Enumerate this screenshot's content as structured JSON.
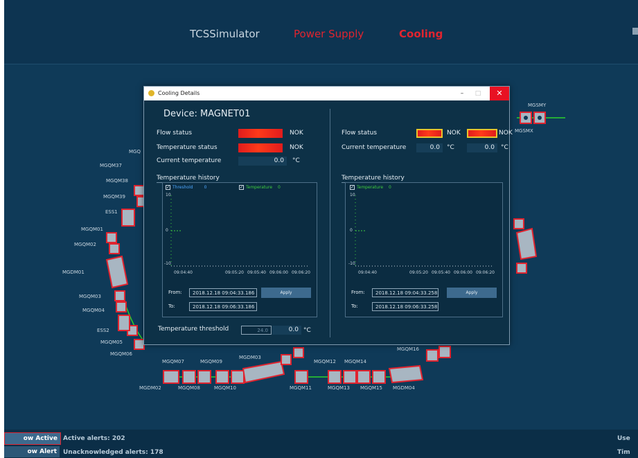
{
  "app": {
    "nav": [
      "TCSSimulator",
      "Power Supply",
      "Cooling"
    ]
  },
  "ring_labels": [
    "MGQM37",
    "MGQM38",
    "MGQM39",
    "ESS1",
    "MGQM01",
    "MGQM02",
    "MGDM01",
    "MGQM03",
    "MGQM04",
    "ESS2",
    "MGQM05",
    "MGQM06",
    "MGQM07",
    "MGQM09",
    "MGDM03",
    "MGQM12",
    "MGQM14",
    "MGQM16",
    "MGDM02",
    "MGQM08",
    "MGQM10",
    "MGQM11",
    "MGQM13",
    "MGQM15",
    "MGDM04",
    "MGSMY",
    "MGSMX",
    "MGQ"
  ],
  "dialog": {
    "title": "Cooling Details",
    "minimize": "–",
    "maximize": "□",
    "close": "✕",
    "device_label": "Device: MAGNET01",
    "left": {
      "flow_status_label": "Flow status",
      "flow_status_value": "NOK",
      "temp_status_label": "Temperature status",
      "temp_status_value": "NOK",
      "current_temp_label": "Current temperature",
      "current_temp_value": "0.0",
      "current_temp_unit": "°C",
      "history_label": "Temperature history",
      "legend": [
        {
          "label": "Threshold",
          "value": "0",
          "color": "#4da6ff"
        },
        {
          "label": "Temperature",
          "value": "0",
          "color": "#3fcf3f"
        }
      ],
      "y_ticks": [
        "10",
        "0",
        "-10"
      ],
      "x_ticks": [
        "09:04:40",
        "09:05:20",
        "09:05:40",
        "09:06:00",
        "09:06:20"
      ],
      "from_label": "From:",
      "from_value": "2018.12.18 09:04:33.186",
      "to_label": "To:",
      "to_value": "2018.12.18 09:06:33.186",
      "apply": "Apply",
      "threshold_label": "Temperature threshold",
      "threshold_input": "24.0",
      "threshold_value": "0.0",
      "threshold_unit": "°C"
    },
    "right": {
      "flow_status_label": "Flow status",
      "flow_status_value_1": "NOK",
      "flow_status_value_2": "NOK",
      "current_temp_label": "Current temperature",
      "current_temp_value_1": "0.0",
      "current_temp_unit_1": "°C",
      "current_temp_value_2": "0.0",
      "current_temp_unit_2": "°C",
      "history_label": "Temperature history",
      "legend": [
        {
          "label": "Temperature",
          "value": "0",
          "color": "#3fcf3f"
        }
      ],
      "y_ticks": [
        "10",
        "0",
        "-10"
      ],
      "x_ticks": [
        "09:04:40",
        "09:05:20",
        "09:05:40",
        "09:06:00",
        "09:06:20"
      ],
      "from_label": "From:",
      "from_value": "2018.12.18 09:04:33.258",
      "to_label": "To:",
      "to_value": "2018.12.18 09:06:33.258",
      "apply": "Apply"
    }
  },
  "bottom": {
    "btn_active": "ow Active Alerts",
    "btn_history": "ow Alert History",
    "active_alerts": "Active alerts:  202",
    "unack_alerts": "Unacknowledged alerts:  178",
    "right_1": "Use",
    "right_2": "Tim"
  },
  "colors": {
    "accent_red": "#e0242f",
    "background": "#0f3a58",
    "ring_green": "#2bd12b"
  }
}
